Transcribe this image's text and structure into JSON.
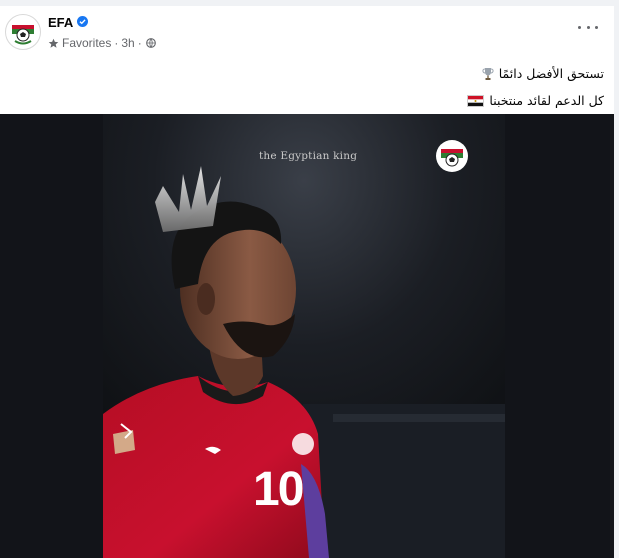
{
  "post": {
    "author": "EFA",
    "verified": true,
    "meta": {
      "favorites_label": "Favorites",
      "separator": "·",
      "time": "3h",
      "audience_icon": "globe-icon"
    },
    "more_icon": "more-options-icon",
    "caption": {
      "line1_text": "تستحق الأفضل دائمًا",
      "line1_emoji": "trophy-icon",
      "line2_text": "كل الدعم لقائد منتخبنا",
      "line2_emoji": "egypt-flag-icon"
    },
    "image": {
      "watermark": "the Egyptian king",
      "jersey_number": "10"
    }
  },
  "colors": {
    "page_bg": "#f0f2f5",
    "card_bg": "#ffffff",
    "primary_text": "#050505",
    "secondary_text": "#65676b",
    "verified_blue": "#1877f2",
    "jersey_red": "#c8102e",
    "photo_bg": "#121419"
  }
}
